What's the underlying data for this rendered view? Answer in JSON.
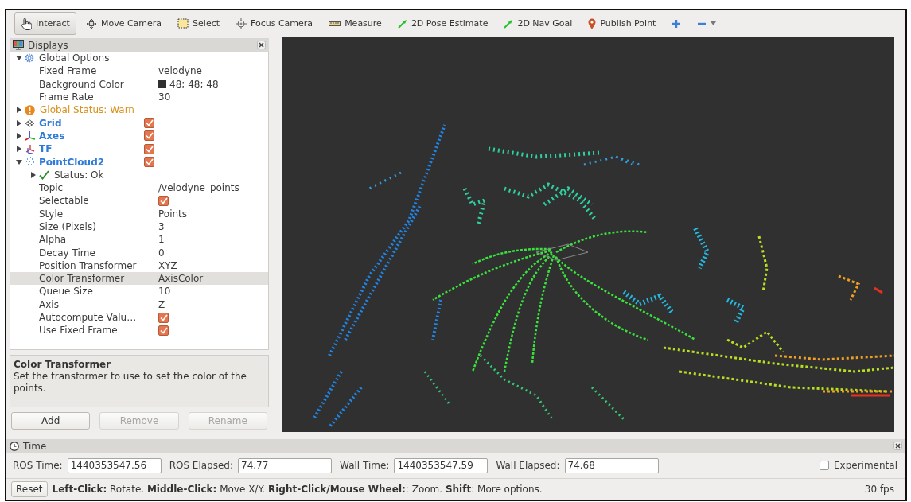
{
  "toolbar": {
    "tools": [
      {
        "kind": "hand",
        "label": "Interact",
        "selected": true
      },
      {
        "kind": "move",
        "label": "Move Camera",
        "selected": false
      },
      {
        "kind": "select",
        "label": "Select",
        "selected": false
      },
      {
        "kind": "focus",
        "label": "Focus Camera",
        "selected": false
      },
      {
        "kind": "measure",
        "label": "Measure",
        "selected": false
      },
      {
        "kind": "pose",
        "label": "2D Pose Estimate",
        "selected": false
      },
      {
        "kind": "nav",
        "label": "2D Nav Goal",
        "selected": false
      },
      {
        "kind": "pin",
        "label": "Publish Point",
        "selected": false
      },
      {
        "kind": "plus",
        "selected": false
      },
      {
        "kind": "minus",
        "selected": false
      }
    ]
  },
  "displays": {
    "title": "Displays",
    "tree": [
      {
        "kind": "options",
        "label": "Global Options",
        "expanded": true,
        "selected": false,
        "children": [
          {
            "kind": "property",
            "label": "Fixed Frame",
            "value": "velodyne",
            "selected": false
          },
          {
            "kind": "color",
            "label": "Background Color",
            "value": "48; 48; 48",
            "selected": false
          },
          {
            "kind": "property",
            "label": "Frame Rate",
            "value": "30",
            "selected": false
          }
        ]
      },
      {
        "kind": "warning",
        "label": "Global Status: Warn",
        "expanded": false,
        "selected": false
      },
      {
        "kind": "grid",
        "label": "Grid",
        "expanded": false,
        "checked": true,
        "selected": false
      },
      {
        "kind": "axes",
        "label": "Axes",
        "expanded": false,
        "checked": true,
        "selected": false
      },
      {
        "kind": "tf",
        "label": "TF",
        "expanded": false,
        "checked": true,
        "selected": false
      },
      {
        "kind": "pointcloud",
        "label": "PointCloud2",
        "expanded": true,
        "checked": true,
        "selected": false,
        "children": [
          {
            "kind": "ok",
            "label": "Status: Ok",
            "expanded": false,
            "selected": false
          },
          {
            "kind": "property",
            "label": "Topic",
            "value": "/velodyne_points",
            "selected": false
          },
          {
            "kind": "check",
            "label": "Selectable",
            "checked": true,
            "selected": false
          },
          {
            "kind": "property",
            "label": "Style",
            "value": "Points",
            "selected": false
          },
          {
            "kind": "property",
            "label": "Size (Pixels)",
            "value": "3",
            "selected": false
          },
          {
            "kind": "property",
            "label": "Alpha",
            "value": "1",
            "selected": false
          },
          {
            "kind": "property",
            "label": "Decay Time",
            "value": "0",
            "selected": false
          },
          {
            "kind": "property",
            "label": "Position Transformer",
            "value": "XYZ",
            "selected": false
          },
          {
            "kind": "property",
            "label": "Color Transformer",
            "value": "AxisColor",
            "selected": true
          },
          {
            "kind": "property",
            "label": "Queue Size",
            "value": "10",
            "selected": false
          },
          {
            "kind": "property",
            "label": "Axis",
            "value": "Z",
            "selected": false
          },
          {
            "kind": "check",
            "label": "Autocompute Valu…",
            "checked": true,
            "selected": false
          },
          {
            "kind": "check",
            "label": "Use Fixed Frame",
            "checked": true,
            "selected": false
          }
        ]
      }
    ],
    "description": {
      "title": "Color Transformer",
      "text": "Set the transformer to use to set the color of the points."
    },
    "buttons": [
      {
        "label": "Add",
        "disabled": false
      },
      {
        "label": "Remove",
        "disabled": true
      },
      {
        "label": "Rename",
        "disabled": true
      }
    ]
  },
  "time": {
    "title": "Time",
    "fields": [
      {
        "label": "ROS Time:",
        "value": "1440353547.56"
      },
      {
        "label": "ROS Elapsed:",
        "value": "74.77"
      },
      {
        "label": "Wall Time:",
        "value": "1440353547.59"
      },
      {
        "label": "Wall Elapsed:",
        "value": "74.68"
      }
    ],
    "experimental": {
      "label": "Experimental",
      "checked": false
    }
  },
  "status_bar": {
    "reset": "Reset",
    "help": "**Left-Click:** Rotate. **Middle-Click:** Move X/Y. **Right-Click/Mouse Wheel:**: Zoom. **Shift**: More options.",
    "fps": "30 fps"
  }
}
